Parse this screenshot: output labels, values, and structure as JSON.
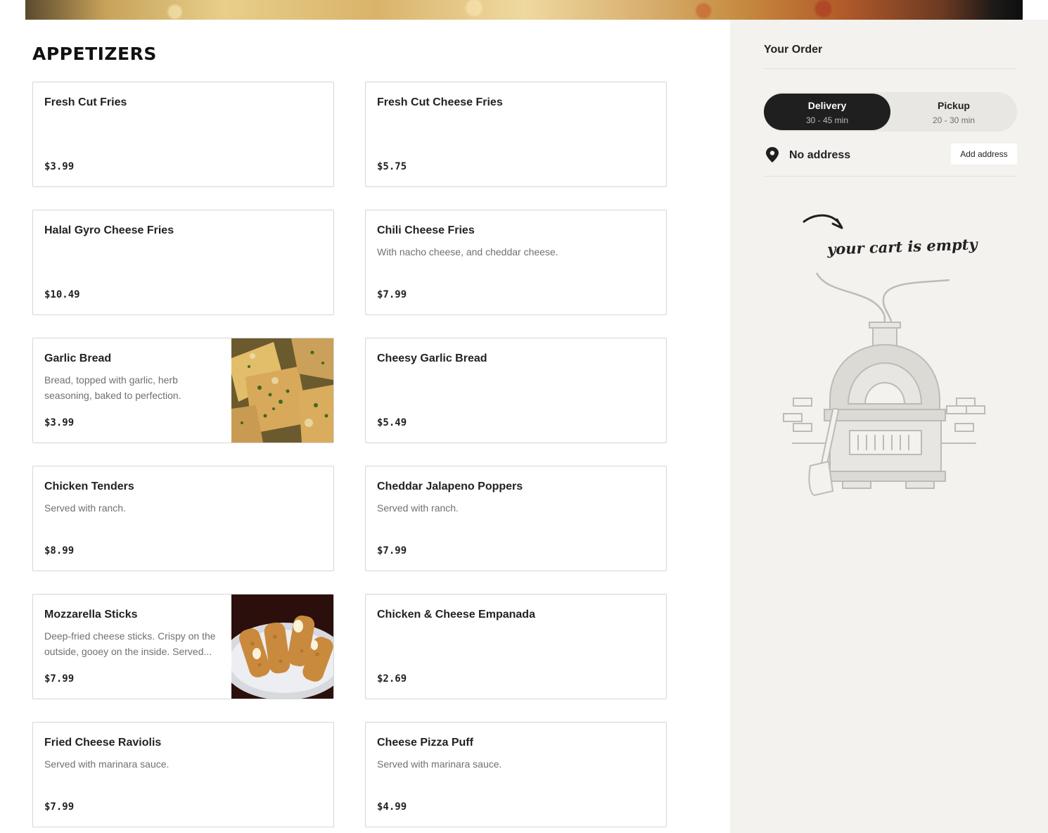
{
  "menu": {
    "section_title": "APPETIZERS",
    "items": [
      {
        "name": "Fresh Cut Fries",
        "description": "",
        "price": "$3.99",
        "has_image": false
      },
      {
        "name": "Fresh Cut Cheese Fries",
        "description": "",
        "price": "$5.75",
        "has_image": false
      },
      {
        "name": "Halal Gyro Cheese Fries",
        "description": "",
        "price": "$10.49",
        "has_image": false
      },
      {
        "name": "Chili Cheese Fries",
        "description": "With nacho cheese, and cheddar cheese.",
        "price": "$7.99",
        "has_image": false
      },
      {
        "name": "Garlic Bread",
        "description": "Bread, topped with garlic, herb seasoning, baked to perfection.",
        "price": "$3.99",
        "has_image": true
      },
      {
        "name": "Cheesy Garlic Bread",
        "description": "",
        "price": "$5.49",
        "has_image": false
      },
      {
        "name": "Chicken Tenders",
        "description": "Served with ranch.",
        "price": "$8.99",
        "has_image": false
      },
      {
        "name": "Cheddar Jalapeno Poppers",
        "description": "Served with ranch.",
        "price": "$7.99",
        "has_image": false
      },
      {
        "name": "Mozzarella Sticks",
        "description": "Deep-fried cheese sticks. Crispy on the outside, gooey on the inside. Served...",
        "price": "$7.99",
        "has_image": true
      },
      {
        "name": "Chicken & Cheese Empanada",
        "description": "",
        "price": "$2.69",
        "has_image": false
      },
      {
        "name": "Fried Cheese Raviolis",
        "description": "Served with marinara sauce.",
        "price": "$7.99",
        "has_image": false
      },
      {
        "name": "Cheese Pizza Puff",
        "description": "Served with marinara sauce.",
        "price": "$4.99",
        "has_image": false
      }
    ]
  },
  "order": {
    "title": "Your Order",
    "delivery_label": "Delivery",
    "delivery_time": "30 - 45 min",
    "pickup_label": "Pickup",
    "pickup_time": "20 - 30 min",
    "address_icon": "location-pin-icon",
    "address_text": "No address",
    "add_address_label": "Add address",
    "empty_text": "your cart is empty"
  },
  "colors": {
    "sidebar_bg": "#f3f2ef",
    "toggle_active": "#1f1f1f",
    "card_border": "#d6d6d6"
  }
}
